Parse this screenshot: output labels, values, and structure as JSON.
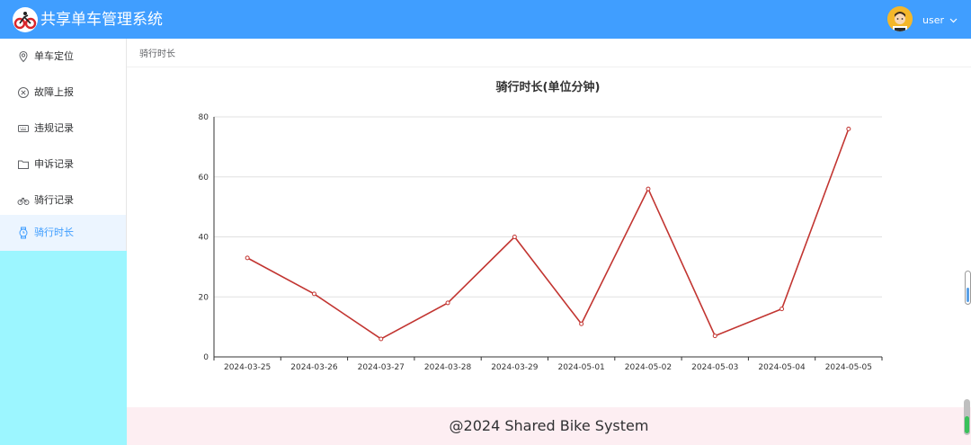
{
  "header": {
    "title": "共享单车管理系统",
    "user_label": "user",
    "bg_color": "#409eff"
  },
  "sidebar": {
    "items": [
      {
        "label": "单车定位",
        "icon": "location-pin-icon",
        "active": false
      },
      {
        "label": "故障上报",
        "icon": "circle-x-icon",
        "active": false
      },
      {
        "label": "违规记录",
        "icon": "keyboard-icon",
        "active": false
      },
      {
        "label": "申诉记录",
        "icon": "folder-icon",
        "active": false
      },
      {
        "label": "骑行记录",
        "icon": "bicycle-icon",
        "active": false
      },
      {
        "label": "骑行时长",
        "icon": "watch-icon",
        "active": true
      }
    ],
    "active_color": "#409eff"
  },
  "breadcrumb": {
    "current": "骑行时长"
  },
  "chart_data": {
    "type": "line",
    "title": "骑行时长(单位分钟)",
    "xlabel": "",
    "ylabel": "",
    "categories": [
      "2024-03-25",
      "2024-03-26",
      "2024-03-27",
      "2024-03-28",
      "2024-03-29",
      "2024-05-01",
      "2024-05-02",
      "2024-05-03",
      "2024-05-04",
      "2024-05-05"
    ],
    "series": [
      {
        "values": [
          33,
          21,
          6,
          18,
          40,
          11,
          56,
          7,
          16,
          76
        ]
      }
    ],
    "ylim": [
      0,
      80
    ],
    "yticks": [
      0,
      20,
      40,
      60,
      80
    ],
    "grid": true,
    "line_color": "#c23531"
  },
  "footer": {
    "text": "@2024 Shared Bike System"
  }
}
